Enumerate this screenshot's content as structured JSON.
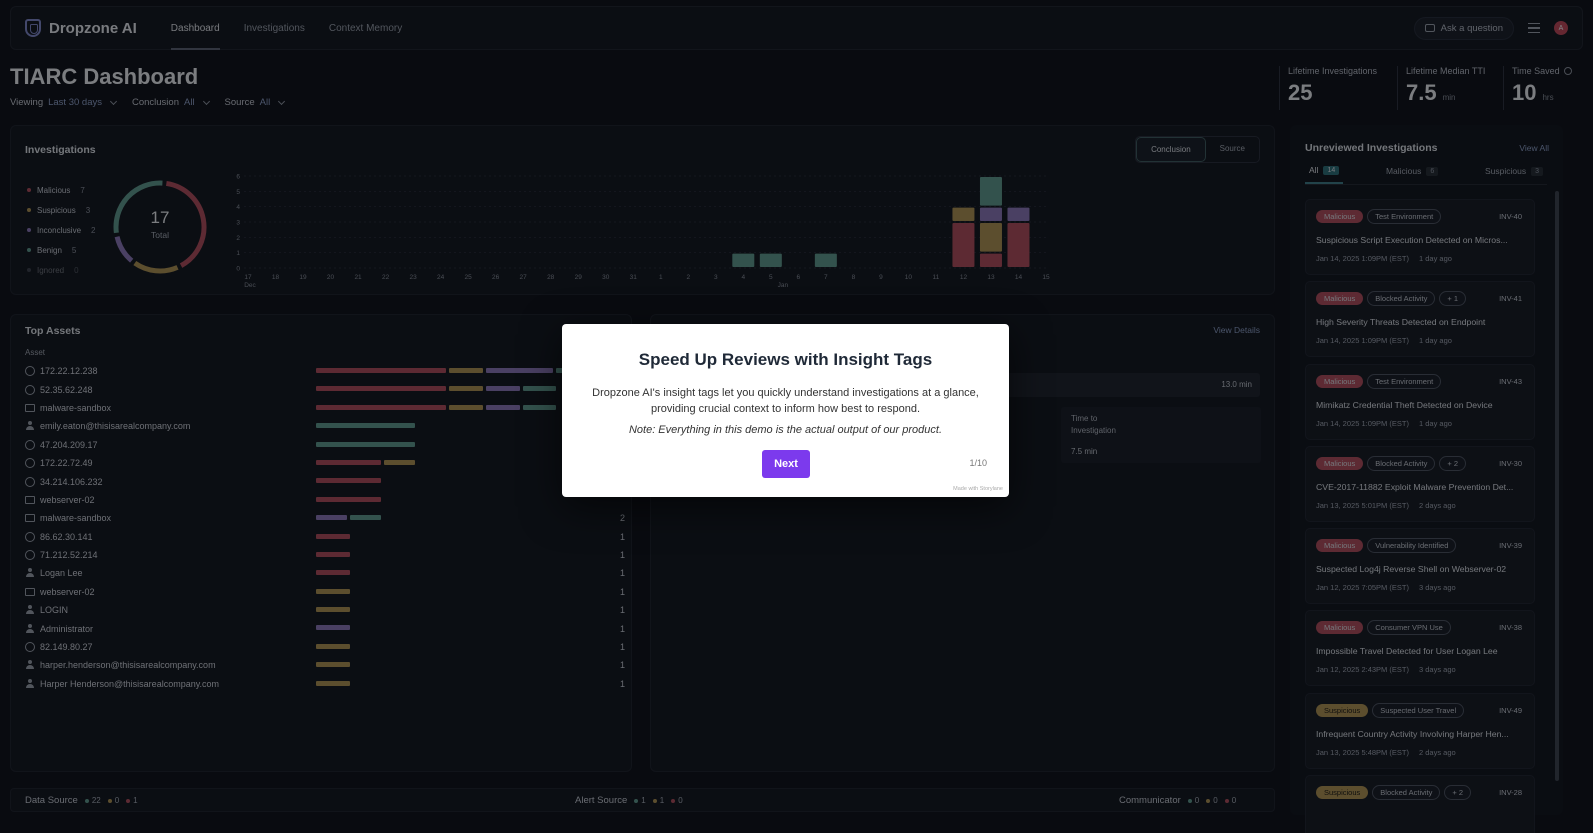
{
  "nav": {
    "brand": "Dropzone AI",
    "tabs": [
      "Dashboard",
      "Investigations",
      "Context Memory"
    ],
    "ask": "Ask a question",
    "avatar": "A"
  },
  "header": {
    "title": "TIARC Dashboard",
    "filters": [
      {
        "label": "Viewing",
        "value": "Last 30 days"
      },
      {
        "label": "Conclusion",
        "value": "All"
      },
      {
        "label": "Source",
        "value": "All"
      }
    ],
    "stats": [
      {
        "label": "Lifetime Investigations",
        "value": "25",
        "unit": ""
      },
      {
        "label": "Lifetime Median TTI",
        "value": "7.5",
        "unit": "min"
      },
      {
        "label": "Time Saved",
        "value": "10",
        "unit": "hrs"
      }
    ]
  },
  "investigations": {
    "title": "Investigations",
    "toggle": [
      "Conclusion",
      "Source"
    ],
    "legend": [
      {
        "label": "Malicious",
        "count": "7"
      },
      {
        "label": "Suspicious",
        "count": "3"
      },
      {
        "label": "Inconclusive",
        "count": "2"
      },
      {
        "label": "Benign",
        "count": "5"
      },
      {
        "label": "Ignored",
        "count": "0"
      }
    ],
    "total": "17",
    "total_label": "Total"
  },
  "colors": {
    "malicious": "#b24b58",
    "suspicious": "#b0924f",
    "inconclusive": "#8c76b8",
    "benign": "#5f9a8c",
    "ignored": "#444a55"
  },
  "chart_data": {
    "type": "bar",
    "stacked": true,
    "categories": [
      "17",
      "18",
      "19",
      "20",
      "21",
      "22",
      "23",
      "24",
      "25",
      "26",
      "27",
      "28",
      "29",
      "30",
      "31",
      "1",
      "2",
      "3",
      "4",
      "5",
      "6",
      "7",
      "8",
      "9",
      "10",
      "11",
      "12",
      "13",
      "14",
      "15"
    ],
    "month_labels": [
      "Dec",
      "Jan"
    ],
    "ylim": [
      0,
      6
    ],
    "yticks": [
      0,
      1,
      2,
      3,
      4,
      5,
      6
    ],
    "grid": true,
    "series": [
      {
        "name": "Malicious",
        "values": [
          0,
          0,
          0,
          0,
          0,
          0,
          0,
          0,
          0,
          0,
          0,
          0,
          0,
          0,
          0,
          0,
          0,
          0,
          0,
          0,
          0,
          0,
          0,
          0,
          0,
          0,
          3,
          1,
          3,
          0
        ]
      },
      {
        "name": "Suspicious",
        "values": [
          0,
          0,
          0,
          0,
          0,
          0,
          0,
          0,
          0,
          0,
          0,
          0,
          0,
          0,
          0,
          0,
          0,
          0,
          0,
          0,
          0,
          0,
          0,
          0,
          0,
          0,
          1,
          2,
          0,
          0
        ]
      },
      {
        "name": "Inconclusive",
        "values": [
          0,
          0,
          0,
          0,
          0,
          0,
          0,
          0,
          0,
          0,
          0,
          0,
          0,
          0,
          0,
          0,
          0,
          0,
          0,
          0,
          0,
          0,
          0,
          0,
          0,
          0,
          0,
          1,
          1,
          0
        ]
      },
      {
        "name": "Benign",
        "values": [
          0,
          0,
          0,
          0,
          0,
          0,
          0,
          0,
          0,
          0,
          0,
          0,
          0,
          0,
          0,
          0,
          0,
          0,
          1,
          1,
          0,
          1,
          0,
          0,
          0,
          0,
          0,
          2,
          0,
          0
        ]
      }
    ]
  },
  "assets": {
    "title": "Top Assets",
    "column": "Asset",
    "rows": [
      {
        "name": "172.22.12.238",
        "icon": "globe-icon",
        "count": "",
        "segments": [
          {
            "c": "malicious",
            "v": 5
          },
          {
            "c": "suspicious",
            "v": 1.3
          },
          {
            "c": "inconclusive",
            "v": 2.6
          },
          {
            "c": "benign",
            "v": 1.2
          }
        ]
      },
      {
        "name": "52.35.62.248",
        "icon": "globe-icon",
        "count": "",
        "segments": [
          {
            "c": "malicious",
            "v": 5
          },
          {
            "c": "suspicious",
            "v": 1.3
          },
          {
            "c": "inconclusive",
            "v": 1.3
          },
          {
            "c": "benign",
            "v": 1.3
          }
        ]
      },
      {
        "name": "malware-sandbox",
        "icon": "laptop-icon",
        "count": "",
        "segments": [
          {
            "c": "malicious",
            "v": 5
          },
          {
            "c": "suspicious",
            "v": 1.3
          },
          {
            "c": "inconclusive",
            "v": 1.3
          },
          {
            "c": "benign",
            "v": 1.3
          }
        ]
      },
      {
        "name": "emily.eaton@thisisarealcompany.com",
        "icon": "user-icon",
        "count": "",
        "segments": [
          {
            "c": "benign",
            "v": 3.8
          }
        ]
      },
      {
        "name": "47.204.209.17",
        "icon": "globe-icon",
        "count": "",
        "segments": [
          {
            "c": "benign",
            "v": 3.8
          }
        ]
      },
      {
        "name": "172.22.72.49",
        "icon": "globe-icon",
        "count": "",
        "segments": [
          {
            "c": "malicious",
            "v": 2.5
          },
          {
            "c": "suspicious",
            "v": 1.2
          }
        ]
      },
      {
        "name": "34.214.106.232",
        "icon": "globe-icon",
        "count": "",
        "segments": [
          {
            "c": "malicious",
            "v": 2.5
          }
        ]
      },
      {
        "name": "webserver-02",
        "icon": "laptop-icon",
        "count": "",
        "segments": [
          {
            "c": "malicious",
            "v": 2.5
          }
        ]
      },
      {
        "name": "malware-sandbox",
        "icon": "laptop-icon",
        "count": "2",
        "segments": [
          {
            "c": "inconclusive",
            "v": 1.2
          },
          {
            "c": "benign",
            "v": 1.2
          }
        ]
      },
      {
        "name": "86.62.30.141",
        "icon": "globe-icon",
        "count": "1",
        "segments": [
          {
            "c": "malicious",
            "v": 1.3
          }
        ]
      },
      {
        "name": "71.212.52.214",
        "icon": "globe-icon",
        "count": "1",
        "segments": [
          {
            "c": "malicious",
            "v": 1.3
          }
        ]
      },
      {
        "name": "Logan Lee",
        "icon": "user-icon",
        "count": "1",
        "segments": [
          {
            "c": "malicious",
            "v": 1.3
          }
        ]
      },
      {
        "name": "webserver-02",
        "icon": "laptop-icon",
        "count": "1",
        "segments": [
          {
            "c": "suspicious",
            "v": 1.3
          }
        ]
      },
      {
        "name": "LOGIN",
        "icon": "user-icon",
        "count": "1",
        "segments": [
          {
            "c": "suspicious",
            "v": 1.3
          }
        ]
      },
      {
        "name": "Administrator",
        "icon": "user-icon",
        "count": "1",
        "segments": [
          {
            "c": "inconclusive",
            "v": 1.3
          }
        ]
      },
      {
        "name": "82.149.80.27",
        "icon": "globe-icon",
        "count": "1",
        "segments": [
          {
            "c": "suspicious",
            "v": 1.3
          }
        ]
      },
      {
        "name": "harper.henderson@thisisarealcompany.com",
        "icon": "user-icon",
        "count": "1",
        "segments": [
          {
            "c": "suspicious",
            "v": 1.3
          }
        ]
      },
      {
        "name": "Harper Henderson@thisisarealcompany.com",
        "icon": "user-icon",
        "count": "1",
        "segments": [
          {
            "c": "suspicious",
            "v": 1.3
          }
        ]
      }
    ]
  },
  "tti": {
    "view_details": "View Details",
    "bar_value": "13.0 min",
    "label": "Time to Investigation",
    "value": "7.5 min"
  },
  "unreviewed": {
    "title": "Unreviewed Investigations",
    "view_all": "View All",
    "tabs": [
      {
        "label": "All",
        "count": "14"
      },
      {
        "label": "Malicious",
        "count": "6"
      },
      {
        "label": "Suspicious",
        "count": "3"
      }
    ],
    "cards": [
      {
        "verdict": "Malicious",
        "kind": "mal",
        "tag": "Test Environment",
        "extra": "",
        "id": "INV-40",
        "title": "Suspicious Script Execution Detected on Micros...",
        "date": "Jan 14, 2025 1:09PM (EST)",
        "ago": "1 day ago"
      },
      {
        "verdict": "Malicious",
        "kind": "mal",
        "tag": "Blocked Activity",
        "extra": "+ 1",
        "id": "INV-41",
        "title": "High Severity Threats Detected on Endpoint",
        "date": "Jan 14, 2025 1:09PM (EST)",
        "ago": "1 day ago"
      },
      {
        "verdict": "Malicious",
        "kind": "mal",
        "tag": "Test Environment",
        "extra": "",
        "id": "INV-43",
        "title": "Mimikatz Credential Theft Detected on Device",
        "date": "Jan 14, 2025 1:09PM (EST)",
        "ago": "1 day ago"
      },
      {
        "verdict": "Malicious",
        "kind": "mal",
        "tag": "Blocked Activity",
        "extra": "+ 2",
        "id": "INV-30",
        "title": "CVE-2017-11882 Exploit Malware Prevention Det...",
        "date": "Jan 13, 2025 5:01PM (EST)",
        "ago": "2 days ago"
      },
      {
        "verdict": "Malicious",
        "kind": "mal",
        "tag": "Vulnerability Identified",
        "extra": "",
        "id": "INV-39",
        "title": "Suspected Log4j Reverse Shell on Webserver-02",
        "date": "Jan 12, 2025 7:05PM (EST)",
        "ago": "3 days ago"
      },
      {
        "verdict": "Malicious",
        "kind": "mal",
        "tag": "Consumer VPN Use",
        "extra": "",
        "id": "INV-38",
        "title": "Impossible Travel Detected for User Logan Lee",
        "date": "Jan 12, 2025 2:43PM (EST)",
        "ago": "3 days ago"
      },
      {
        "verdict": "Suspicious",
        "kind": "sus",
        "tag": "Suspected User Travel",
        "extra": "",
        "id": "INV-49",
        "title": "Infrequent Country Activity Involving Harper Hen...",
        "date": "Jan 13, 2025 5:48PM (EST)",
        "ago": "2 days ago"
      },
      {
        "verdict": "Suspicious",
        "kind": "sus",
        "tag": "Blocked Activity",
        "extra": "+ 2",
        "id": "INV-28",
        "title": "",
        "date": "",
        "ago": ""
      }
    ]
  },
  "bottom": {
    "groups": [
      {
        "label": "Data Source",
        "counts": [
          "22",
          "0",
          "1"
        ]
      },
      {
        "label": "Alert Source",
        "counts": [
          "1",
          "1",
          "0"
        ]
      },
      {
        "label": "Communicator",
        "counts": [
          "0",
          "0",
          "0"
        ]
      }
    ]
  },
  "modal": {
    "title": "Speed Up Reviews with Insight Tags",
    "body": "Dropzone AI's insight tags let you quickly understand investigations at a glance, providing crucial context to inform how best to respond.",
    "note": "Note: Everything in this demo is the actual output of our product.",
    "next": "Next",
    "step": "1/10",
    "made_with": "Made with Storylane"
  }
}
